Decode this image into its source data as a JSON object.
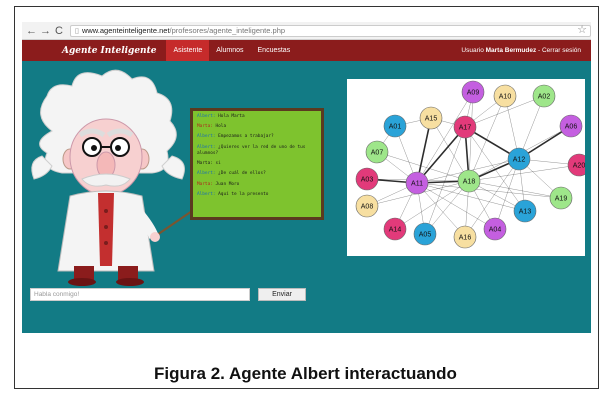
{
  "browser": {
    "back_icon": "back-arrow-icon",
    "forward_icon": "forward-arrow-icon",
    "reload_icon": "reload-icon",
    "url_domain": "www.agenteinteligente.net",
    "url_path": "/profesores/agente_inteligente.php"
  },
  "header": {
    "brand": "Agente Inteligente",
    "nav": [
      "Asistente",
      "Alumnos",
      "Encuestas"
    ],
    "active_index": 0,
    "user_label": "Usuario",
    "user_name": "Marta Bermudez",
    "separator": " - ",
    "logout": "Cerrar sesión"
  },
  "chat": {
    "lines": [
      {
        "who": "Albert",
        "text": "Hola Marta",
        "color": "albert"
      },
      {
        "who": "Marta",
        "text": "Hola",
        "color": "marta"
      },
      {
        "who": "Albert",
        "text": "Empezamos a trabajar?",
        "color": "albert"
      },
      {
        "who": "Albert",
        "text": "¿Quieres ver la red de uno de tus alumnos?",
        "color": "albert"
      },
      {
        "who": "Marta",
        "text": "si",
        "color": "plain"
      },
      {
        "who": "Albert",
        "text": "¿De cuál de ellos?",
        "color": "albert"
      },
      {
        "who": "Marta",
        "text": "Juan Moro",
        "color": "marta"
      },
      {
        "who": "Albert",
        "text": "Aquí te la presento",
        "color": "albert"
      }
    ]
  },
  "graph": {
    "nodes": [
      {
        "id": "A01",
        "color": "#2aa3d8"
      },
      {
        "id": "A02",
        "color": "#9ee68a"
      },
      {
        "id": "A03",
        "color": "#e23a7a"
      },
      {
        "id": "A04",
        "color": "#c45fe0"
      },
      {
        "id": "A06",
        "color": "#c45fe0"
      },
      {
        "id": "A07",
        "color": "#9ee68a"
      },
      {
        "id": "A08",
        "color": "#f7dfa1"
      },
      {
        "id": "A09",
        "color": "#c45fe0"
      },
      {
        "id": "A10",
        "color": "#f7dfa1"
      },
      {
        "id": "A11",
        "color": "#c45fe0"
      },
      {
        "id": "A12",
        "color": "#2aa3d8"
      },
      {
        "id": "A13",
        "color": "#2aa3d8"
      },
      {
        "id": "A14",
        "color": "#e23a7a"
      },
      {
        "id": "A15",
        "color": "#f7dfa1"
      },
      {
        "id": "A16",
        "color": "#f7dfa1"
      },
      {
        "id": "A17",
        "color": "#e23a7a"
      },
      {
        "id": "A18",
        "color": "#9ee68a"
      },
      {
        "id": "A19",
        "color": "#9ee68a"
      },
      {
        "id": "A20",
        "color": "#e23a7a"
      },
      {
        "id": "A05",
        "color": "#2aa3d8"
      }
    ]
  },
  "input": {
    "placeholder": "Habla conmigo!",
    "send_label": "Enviar"
  },
  "caption": "Figura 2.  Agente Albert interactuando",
  "colors": {
    "header": "#8b1c1c",
    "active_tab": "#c62b2b",
    "body": "#127b85",
    "chat_bg": "#7ec32e",
    "chat_border": "#5b3a1f"
  }
}
